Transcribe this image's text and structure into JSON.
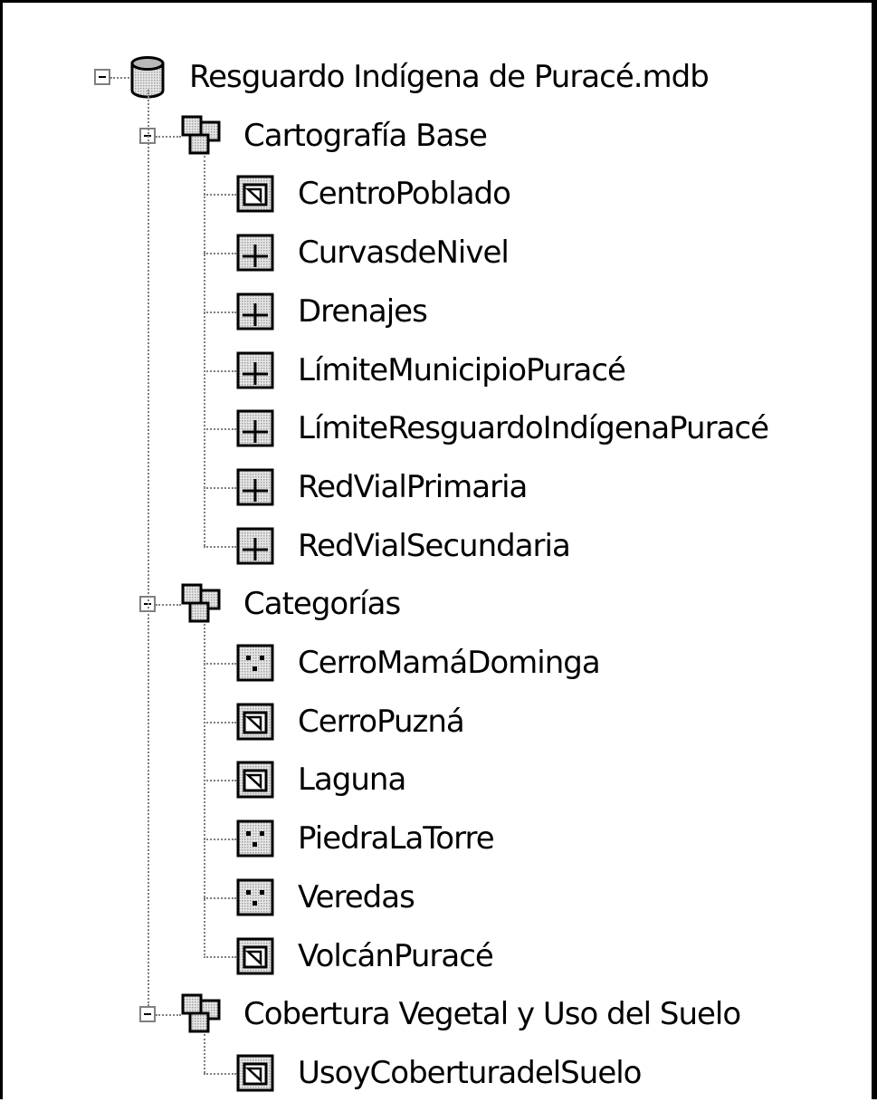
{
  "root": {
    "label": "Resguardo Indígena de Puracé.mdb",
    "icon": "database-icon"
  },
  "groups": [
    {
      "label": "Cartografía Base",
      "icon": "feature-dataset-icon",
      "items": [
        {
          "label": "CentroPoblado",
          "icon": "polygon-feature-class-icon"
        },
        {
          "label": "CurvasdeNivel",
          "icon": "line-feature-class-icon"
        },
        {
          "label": "Drenajes",
          "icon": "line-feature-class-icon"
        },
        {
          "label": "LímiteMunicipioPuracé",
          "icon": "line-feature-class-icon"
        },
        {
          "label": "LímiteResguardoIndígenaPuracé",
          "icon": "line-feature-class-icon"
        },
        {
          "label": "RedVialPrimaria",
          "icon": "line-feature-class-icon"
        },
        {
          "label": "RedVialSecundaria",
          "icon": "line-feature-class-icon"
        }
      ]
    },
    {
      "label": "Categorías",
      "icon": "feature-dataset-icon",
      "items": [
        {
          "label": "CerroMamáDominga",
          "icon": "point-feature-class-icon"
        },
        {
          "label": "CerroPuzná",
          "icon": "polygon-feature-class-icon"
        },
        {
          "label": "Laguna",
          "icon": "polygon-feature-class-icon"
        },
        {
          "label": "PiedraLaTorre",
          "icon": "point-feature-class-icon"
        },
        {
          "label": "Veredas",
          "icon": "point-feature-class-icon"
        },
        {
          "label": "VolcánPuracé",
          "icon": "polygon-feature-class-icon"
        }
      ]
    },
    {
      "label": "Cobertura Vegetal y Uso del Suelo",
      "icon": "feature-dataset-icon",
      "items": [
        {
          "label": "UsoyCoberturadelSuelo",
          "icon": "polygon-feature-class-icon"
        }
      ]
    }
  ]
}
